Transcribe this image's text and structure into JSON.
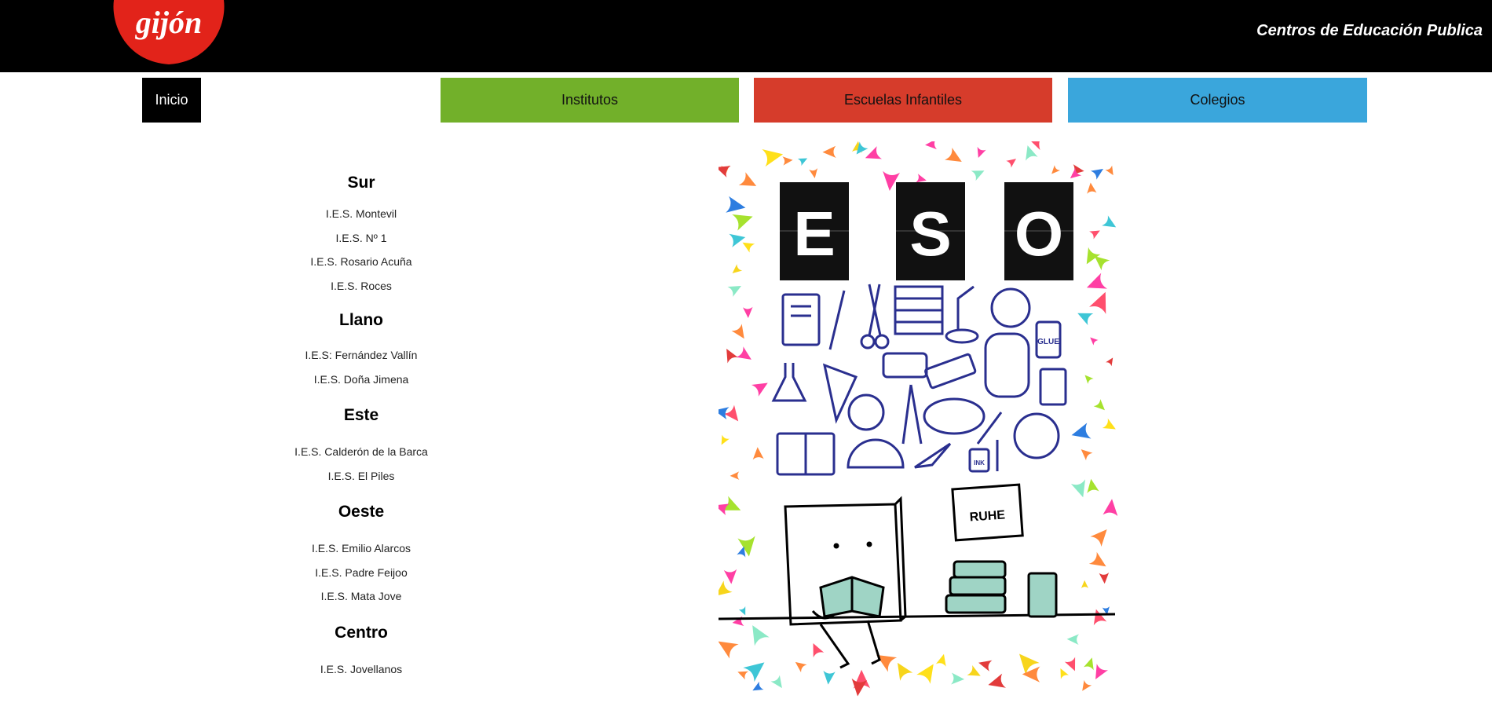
{
  "header": {
    "logo_text": "gijón",
    "site_title": "Centros de Educación Publica",
    "logo_color": "#e2231a"
  },
  "nav": {
    "inicio": "Inicio",
    "institutos": "Institutos",
    "escuelas": "Escuelas Infantiles",
    "colegios": "Colegios"
  },
  "zones": [
    {
      "name": "Sur",
      "schools": [
        "I.E.S. Montevil",
        "I.E.S. Nº 1",
        "I.E.S. Rosario Acuña",
        "I.E.S. Roces"
      ]
    },
    {
      "name": "Llano",
      "schools": [
        "I.E.S: Fernández Vallín",
        "I.E.S. Doña Jimena"
      ]
    },
    {
      "name": "Este",
      "schools": [
        "I.E.S. Calderón de la Barca",
        "I.E.S. El Piles"
      ]
    },
    {
      "name": "Oeste",
      "schools": [
        "I.E.S. Emilio Alarcos",
        "I.E.S. Padre Feijoo",
        "I.E.S. Mata Jove"
      ]
    },
    {
      "name": "Centro",
      "schools": [
        "I.E.S. Jovellanos"
      ]
    }
  ],
  "poster": {
    "letters": [
      "E",
      "S",
      "O"
    ],
    "glue_label": "GLUE",
    "ink_label": "INK",
    "note_label": "RUHE"
  }
}
